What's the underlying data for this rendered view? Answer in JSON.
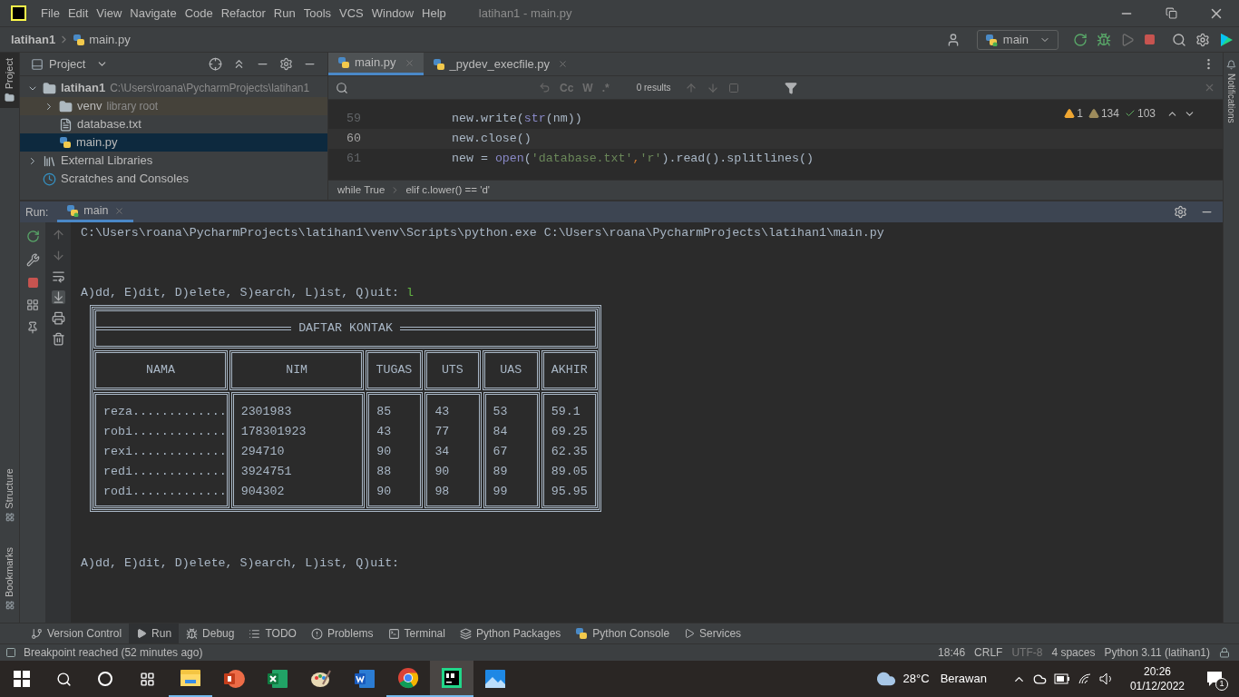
{
  "window": {
    "title": "latihan1 - main.py"
  },
  "menu": [
    "File",
    "Edit",
    "View",
    "Navigate",
    "Code",
    "Refactor",
    "Run",
    "Tools",
    "VCS",
    "Window",
    "Help"
  ],
  "breadcrumb": [
    "latihan1",
    "main.py"
  ],
  "toolbar": {
    "run_config": "main"
  },
  "project": {
    "title": "Project",
    "tree": [
      {
        "label": "latihan1",
        "hint": "C:\\Users\\roana\\PycharmProjects\\latihan1",
        "kind": "folder",
        "expanded": true,
        "selected": false,
        "children": [
          {
            "label": "venv",
            "hint": "library root",
            "kind": "library-folder",
            "expanded": false,
            "selected": false
          },
          {
            "label": "database.txt",
            "kind": "text",
            "selected": false
          },
          {
            "label": "main.py",
            "kind": "python",
            "selected": true
          }
        ]
      },
      {
        "label": "External Libraries",
        "kind": "libraries",
        "expanded": false,
        "selected": false
      },
      {
        "label": "Scratches and Consoles",
        "kind": "scratches",
        "selected": false
      }
    ]
  },
  "editor": {
    "tabs": [
      {
        "label": "main.py",
        "selected": true
      },
      {
        "label": "_pydev_execfile.py",
        "selected": false
      }
    ],
    "find": {
      "toggles": [
        "Cc",
        "W",
        ".*"
      ],
      "results": "0 results"
    },
    "inspections": [
      {
        "kind": "error",
        "count": "1"
      },
      {
        "kind": "warning",
        "count": "134"
      },
      {
        "kind": "typo",
        "count": "103"
      }
    ],
    "lines": [
      {
        "number": "59",
        "current": false,
        "tokens": [
          {
            "text": "new.write(",
            "kind": "plain"
          },
          {
            "text": "str",
            "kind": "builtin"
          },
          {
            "text": "(nm))",
            "kind": "plain"
          }
        ]
      },
      {
        "number": "60",
        "current": true,
        "tokens": [
          {
            "text": "new.close()",
            "kind": "plain"
          }
        ]
      },
      {
        "number": "61",
        "current": false,
        "tokens": [
          {
            "text": "new = ",
            "kind": "plain"
          },
          {
            "text": "open",
            "kind": "builtin"
          },
          {
            "text": "(",
            "kind": "plain"
          },
          {
            "text": "'database.txt'",
            "kind": "string"
          },
          {
            "text": ",",
            "kind": "punct"
          },
          {
            "text": "'r'",
            "kind": "string"
          },
          {
            "text": ").read().splitlines()",
            "kind": "plain"
          }
        ]
      }
    ],
    "path": [
      "while True",
      "elif c.lower() == 'd'"
    ]
  },
  "run": {
    "label": "Run:",
    "tabs": [
      {
        "label": "main",
        "selected": true
      }
    ],
    "console": [
      {
        "kind": "line",
        "text": "C:\\Users\\roana\\PycharmProjects\\latihan1\\venv\\Scripts\\python.exe C:\\Users\\roana\\PycharmProjects\\latihan1\\main.py"
      },
      {
        "kind": "blank"
      },
      {
        "kind": "blank"
      },
      {
        "kind": "prompt",
        "text": "A)dd, E)dit, D)elete, S)earch, L)ist, Q)uit: ",
        "input": "l"
      },
      {
        "kind": "table",
        "title": "DAFTAR KONTAK",
        "columns": [
          "NAMA",
          "NIM",
          "TUGAS",
          "UTS",
          "UAS",
          "AKHIR"
        ],
        "rows": [
          [
            "reza.............",
            "2301983",
            "85",
            "43",
            "53",
            "59.1"
          ],
          [
            "robi.............",
            "178301923",
            "43",
            "77",
            "84",
            "69.25"
          ],
          [
            "rexi.............",
            "294710",
            "90",
            "34",
            "67",
            "62.35"
          ],
          [
            "redi.............",
            "3924751",
            "88",
            "90",
            "89",
            "89.05"
          ],
          [
            "rodi.............",
            "904302",
            "90",
            "98",
            "99",
            "95.95"
          ]
        ]
      },
      {
        "kind": "blank"
      },
      {
        "kind": "blank"
      },
      {
        "kind": "prompt",
        "text": "A)dd, E)dit, D)elete, S)earch, L)ist, Q)uit: "
      }
    ]
  },
  "side_tabs_left": [
    {
      "label": "Project",
      "selected": true
    },
    {
      "label": "Structure",
      "selected": false
    },
    {
      "label": "Bookmarks",
      "selected": false
    }
  ],
  "side_tabs_right": [
    "Notifications"
  ],
  "tool_tabs": [
    {
      "label": "Version Control",
      "kind": "vcs",
      "selected": false
    },
    {
      "label": "Run",
      "kind": "run",
      "selected": true
    },
    {
      "label": "Debug",
      "kind": "debug",
      "selected": false
    },
    {
      "label": "TODO",
      "kind": "todo",
      "selected": false
    },
    {
      "label": "Problems",
      "kind": "problems",
      "selected": false
    },
    {
      "label": "Terminal",
      "kind": "terminal",
      "selected": false
    },
    {
      "label": "Python Packages",
      "kind": "packages",
      "selected": false
    },
    {
      "label": "Python Console",
      "kind": "console",
      "selected": false
    },
    {
      "label": "Services",
      "kind": "services",
      "selected": false
    }
  ],
  "status": {
    "message": "Breakpoint reached (52 minutes ago)",
    "items": [
      {
        "text": "18:46",
        "disabled": false
      },
      {
        "text": "CRLF",
        "disabled": false
      },
      {
        "text": "UTF-8",
        "disabled": true
      },
      {
        "text": "4 spaces",
        "disabled": false
      },
      {
        "text": "Python 3.11 (latihan1)",
        "disabled": false
      }
    ]
  },
  "taskbar": {
    "apps": [
      {
        "kind": "explorer",
        "running": true,
        "selected": false
      },
      {
        "kind": "powerpoint",
        "running": false,
        "selected": false
      },
      {
        "kind": "excel",
        "running": false,
        "selected": false
      },
      {
        "kind": "paint",
        "running": false,
        "selected": false
      },
      {
        "kind": "word",
        "running": false,
        "selected": false
      },
      {
        "kind": "chrome",
        "running": true,
        "selected": false
      },
      {
        "kind": "pycharm",
        "running": true,
        "selected": true
      },
      {
        "kind": "photos",
        "running": false,
        "selected": false
      }
    ],
    "weather": {
      "temp": "28°C",
      "text": "Berawan"
    },
    "time": "20:26",
    "date": "01/12/2022",
    "notifications": "1"
  }
}
